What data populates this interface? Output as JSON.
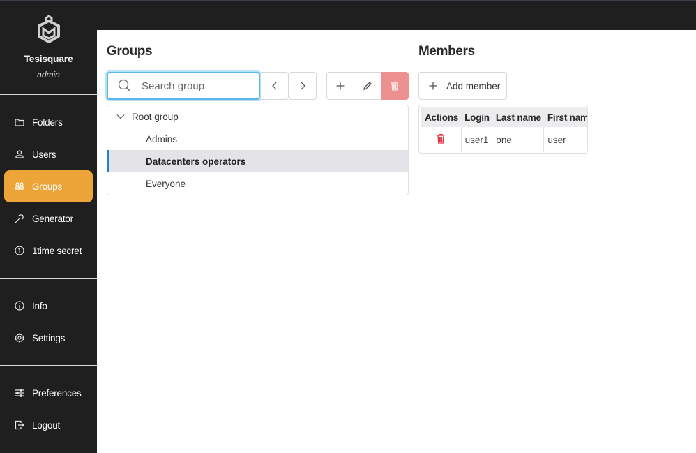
{
  "sidebar": {
    "brand_name": "Tesisquare",
    "role": "admin",
    "logo_icon": "hexagon-m-logo",
    "sections": [
      {
        "items": [
          {
            "label": "Folders",
            "icon": "folder-icon",
            "active": false
          },
          {
            "label": "Users",
            "icon": "user-icon",
            "active": false
          },
          {
            "label": "Groups",
            "icon": "users-group-icon",
            "active": true
          },
          {
            "label": "Generator",
            "icon": "magic-wand-icon",
            "active": false
          },
          {
            "label": "1time secret",
            "icon": "one-circle-icon",
            "active": false
          }
        ]
      },
      {
        "items": [
          {
            "label": "Info",
            "icon": "info-icon",
            "active": false
          },
          {
            "label": "Settings",
            "icon": "gear-icon",
            "active": false
          }
        ]
      },
      {
        "items": [
          {
            "label": "Preferences",
            "icon": "sliders-icon",
            "active": false
          },
          {
            "label": "Logout",
            "icon": "logout-icon",
            "active": false
          }
        ]
      }
    ]
  },
  "groups": {
    "title": "Groups",
    "search": {
      "placeholder": "Search group",
      "value": ""
    },
    "toolbar": {
      "prev": "chevron-left-icon",
      "next": "chevron-right-icon",
      "add": "plus-icon",
      "edit": "pencil-icon",
      "delete": "trash-icon"
    },
    "tree": {
      "root": {
        "label": "Root group",
        "expanded": true
      },
      "children": [
        {
          "label": "Admins",
          "selected": false
        },
        {
          "label": "Datacenters operators",
          "selected": true
        },
        {
          "label": "Everyone",
          "selected": false
        }
      ]
    }
  },
  "members": {
    "title": "Members",
    "add_label": "Add member",
    "columns": [
      "Actions",
      "Login",
      "Last name",
      "First name"
    ],
    "rows": [
      {
        "login": "user1",
        "last_name": "one",
        "first_name": "user"
      }
    ]
  },
  "colors": {
    "sidebar_bg": "#1f1f1f",
    "accent": "#eda53a",
    "selected_bar": "#1d86c8",
    "danger": "#ec9090",
    "danger_icon": "#e2323e",
    "focus": "#5fb6e6"
  }
}
